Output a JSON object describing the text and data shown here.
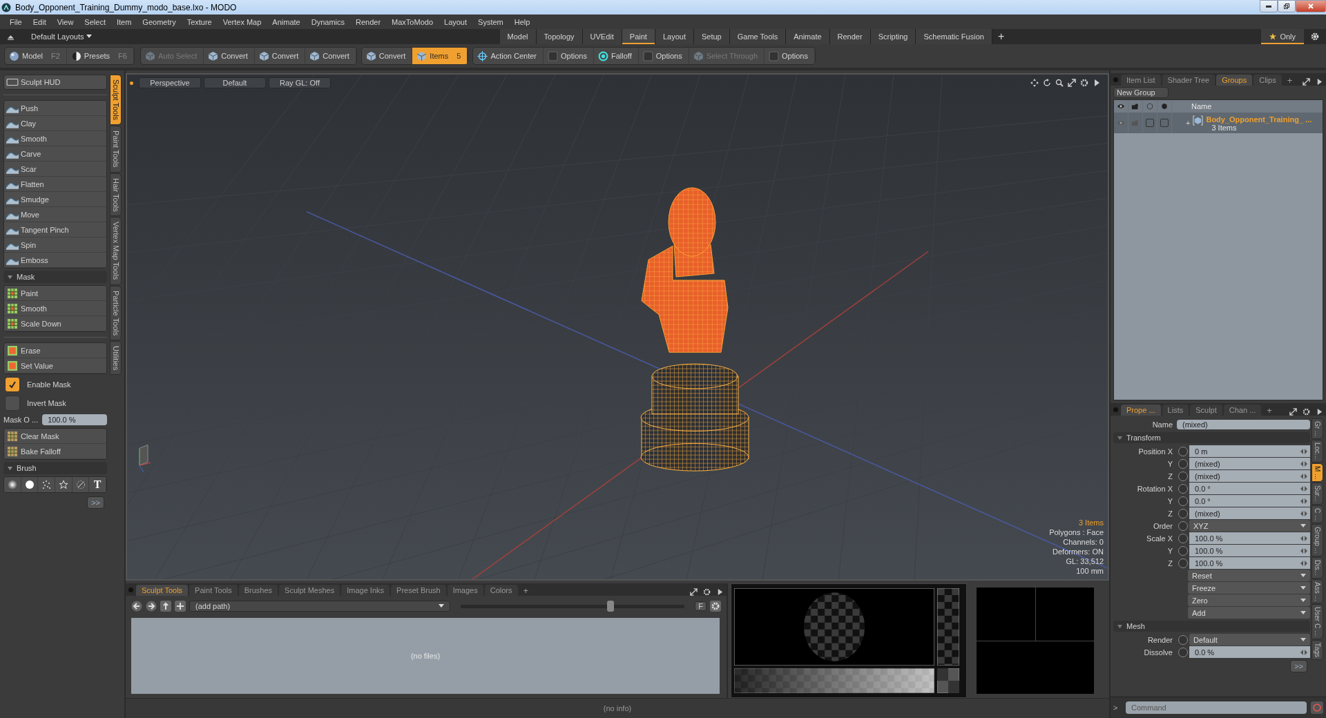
{
  "window": {
    "title": "Body_Opponent_Training_Dummy_modo_base.lxo - MODO"
  },
  "menu": [
    "File",
    "Edit",
    "View",
    "Select",
    "Item",
    "Geometry",
    "Texture",
    "Vertex Map",
    "Animate",
    "Dynamics",
    "Render",
    "MaxToModo",
    "Layout",
    "System",
    "Help"
  ],
  "layout_bar": {
    "layouts": "Default Layouts",
    "tabs": [
      {
        "label": "Model",
        "selected": false
      },
      {
        "label": "Topology",
        "selected": false
      },
      {
        "label": "UVEdit",
        "selected": false
      },
      {
        "label": "Paint",
        "selected": true
      },
      {
        "label": "Layout",
        "selected": false
      },
      {
        "label": "Setup",
        "selected": false
      },
      {
        "label": "Game Tools",
        "selected": false
      },
      {
        "label": "Animate",
        "selected": false
      },
      {
        "label": "Render",
        "selected": false
      },
      {
        "label": "Scripting",
        "selected": false
      },
      {
        "label": "Schematic Fusion",
        "selected": false
      }
    ],
    "add": "+",
    "only": "Only"
  },
  "toolbar": [
    [
      {
        "kind": "sphere",
        "label": "Model",
        "shortcut": "F2",
        "disabled": false,
        "selected": false
      },
      {
        "kind": "presets",
        "label": "Presets",
        "shortcut": "F6",
        "disabled": false,
        "selected": false
      }
    ],
    [
      {
        "kind": "cube",
        "label": "Auto Select",
        "disabled": true,
        "selected": false
      },
      {
        "kind": "cube",
        "label": "Convert",
        "disabled": false,
        "selected": false
      },
      {
        "kind": "cube",
        "label": "Convert",
        "disabled": false,
        "selected": false
      },
      {
        "kind": "cube",
        "label": "Convert",
        "disabled": false,
        "selected": false
      }
    ],
    [
      {
        "kind": "cube",
        "label": "Convert",
        "disabled": false,
        "selected": false
      },
      {
        "kind": "cube",
        "label": "Items",
        "shortcut": "5",
        "disabled": false,
        "selected": true
      }
    ],
    [
      {
        "kind": "target",
        "label": "Action Center",
        "disabled": false,
        "selected": false
      },
      {
        "kind": "box",
        "label": "Options",
        "disabled": false,
        "selected": false
      },
      {
        "kind": "ring",
        "label": "Falloff",
        "disabled": false,
        "selected": false
      },
      {
        "kind": "box",
        "label": "Options",
        "disabled": false,
        "selected": false
      },
      {
        "kind": "cube",
        "label": "Select Through",
        "disabled": true,
        "selected": false
      },
      {
        "kind": "box",
        "label": "Options",
        "disabled": false,
        "selected": false
      }
    ]
  ],
  "left_panel": {
    "hud": "Sculpt HUD",
    "sculpt_tools": [
      "Push",
      "Clay",
      "Smooth",
      "Carve",
      "Scar",
      "Flatten",
      "Smudge",
      "Move",
      "Tangent Pinch",
      "Spin",
      "Emboss"
    ],
    "mask_header": "Mask",
    "mask_tools": [
      "Paint",
      "Smooth",
      "Scale Down"
    ],
    "mask_edit": [
      "Erase",
      "Set Value"
    ],
    "toggles": [
      {
        "label": "Enable Mask",
        "checked": true
      },
      {
        "label": "Invert Mask",
        "checked": false
      }
    ],
    "opacity": {
      "label": "Mask O ...",
      "value": "100.0 %"
    },
    "mask_actions": [
      "Clear Mask",
      "Bake Falloff"
    ],
    "brush_header": "Brush",
    "brushes": [
      {
        "kind": "soft"
      },
      {
        "kind": "hard"
      },
      {
        "kind": "spray"
      },
      {
        "kind": "star"
      },
      {
        "kind": "angle"
      },
      {
        "kind": "text",
        "label": "T"
      }
    ],
    "more": ">>",
    "side_tabs": [
      {
        "label": "Sculpt Tools",
        "selected": true
      },
      {
        "label": "Paint Tools",
        "selected": false
      },
      {
        "label": "Hair Tools",
        "selected": false
      },
      {
        "label": "Vertex Map Tools",
        "selected": false
      },
      {
        "label": "Particle Tools",
        "selected": false
      },
      {
        "label": "Utilities",
        "selected": false
      }
    ]
  },
  "viewport": {
    "options": [
      "Perspective",
      "Default",
      "Ray GL: Off"
    ],
    "info": [
      {
        "text": "3 Items",
        "kind": "highlight"
      },
      {
        "text": "Polygons : Face",
        "kind": "plain"
      },
      {
        "text": "Channels: 0",
        "kind": "plain"
      },
      {
        "text": "Deformers: ON",
        "kind": "plain"
      },
      {
        "text": "GL: 33,512",
        "kind": "plain"
      },
      {
        "text": "100 mm",
        "kind": "plain"
      }
    ]
  },
  "bottom_panel": {
    "tabs": [
      {
        "label": "Sculpt Tools",
        "selected": true
      },
      {
        "label": "Paint Tools",
        "selected": false
      },
      {
        "label": "Brushes",
        "selected": false
      },
      {
        "label": "Sculpt Meshes",
        "selected": false
      },
      {
        "label": "Image Inks",
        "selected": false
      },
      {
        "label": "Preset Brush",
        "selected": false
      },
      {
        "label": "Images",
        "selected": false
      },
      {
        "label": "Colors",
        "selected": false
      }
    ],
    "add": "+",
    "path": "(add path)",
    "slider": {
      "level": 0.67
    },
    "f_button": "F",
    "empty": "(no files)"
  },
  "status_bar": "(no info)",
  "groups_panel": {
    "tabs": [
      {
        "label": "Item List",
        "selected": false
      },
      {
        "label": "Shader Tree",
        "selected": false
      },
      {
        "label": "Groups",
        "selected": true
      },
      {
        "label": "Clips",
        "selected": false
      }
    ],
    "add": "+",
    "new_group": "New Group",
    "column": "Name",
    "rows": [
      {
        "expander": "+",
        "name": "Body_Opponent_Training_ ...",
        "count": "3 Items"
      }
    ]
  },
  "properties": {
    "tabs": [
      {
        "label": "Prope ...",
        "selected": true
      },
      {
        "label": "Lists",
        "selected": false
      },
      {
        "label": "Sculpt",
        "selected": false
      },
      {
        "label": "Chan ...",
        "selected": false
      }
    ],
    "add": "+",
    "name_label": "Name",
    "name_value": "(mixed)",
    "sections": [
      {
        "title": "Transform",
        "rows": [
          {
            "kind": "number",
            "label": "Position X",
            "value": "0 m"
          },
          {
            "kind": "number",
            "label": "Y",
            "value": "(mixed)"
          },
          {
            "kind": "number",
            "label": "Z",
            "value": "(mixed)"
          },
          {
            "kind": "number",
            "label": "Rotation X",
            "value": "0.0 °"
          },
          {
            "kind": "number",
            "label": "Y",
            "value": "0.0 °"
          },
          {
            "kind": "number",
            "label": "Z",
            "value": "(mixed)"
          },
          {
            "kind": "dropdown",
            "label": "Order",
            "value": "XYZ"
          },
          {
            "kind": "number",
            "label": "Scale X",
            "value": "100.0 %"
          },
          {
            "kind": "number",
            "label": "Y",
            "value": "100.0 %"
          },
          {
            "kind": "number",
            "label": "Z",
            "value": "100.0 %"
          },
          {
            "kind": "action",
            "value": "Reset"
          },
          {
            "kind": "action",
            "value": "Freeze"
          },
          {
            "kind": "action",
            "value": "Zero"
          },
          {
            "kind": "action",
            "value": "Add"
          }
        ]
      },
      {
        "title": "Mesh",
        "rows": [
          {
            "kind": "dropdown",
            "label": "Render",
            "value": "Default"
          },
          {
            "kind": "number",
            "label": "Dissolve",
            "value": "0.0 %"
          }
        ]
      }
    ],
    "more": ">>",
    "side_tabs": [
      {
        "label": "Gr ...",
        "selected": false
      },
      {
        "label": "Loc...",
        "selected": false
      },
      {
        "label": "M ...",
        "selected": true
      },
      {
        "label": "Sur...",
        "selected": false
      },
      {
        "label": "C ...",
        "selected": false
      },
      {
        "label": "Group ...",
        "selected": false
      },
      {
        "label": "Dis...",
        "selected": false
      },
      {
        "label": "Ass ...",
        "selected": false
      },
      {
        "label": "User C ...",
        "selected": false
      },
      {
        "label": "Tags",
        "selected": false
      }
    ]
  },
  "command": {
    "prompt": ">",
    "placeholder": "Command"
  }
}
